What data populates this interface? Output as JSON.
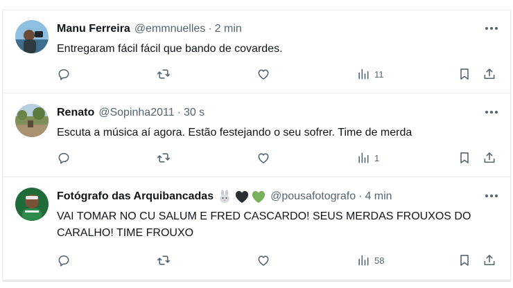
{
  "posts": [
    {
      "name": "Manu Ferreira",
      "handle": "@emmnuelles",
      "separator": "·",
      "time": "2 min",
      "text": "Entregaram fácil fácil que bando de covardes.",
      "views": "11",
      "icons": [
        "reply-icon",
        "repost-icon",
        "like-icon",
        "views-icon",
        "bookmark-icon",
        "share-icon"
      ]
    },
    {
      "name": "Renato",
      "handle": "@Sopinha2011",
      "separator": "·",
      "time": "30 s",
      "text": "Escuta a música aí agora.  Estão festejando o seu sofrer.  Time de merda",
      "views": "1",
      "icons": [
        "reply-icon",
        "repost-icon",
        "like-icon",
        "views-icon",
        "bookmark-icon",
        "share-icon"
      ]
    },
    {
      "name": "Fotógrafo das Arquibancadas",
      "name_emojis": [
        "rabbit-emoji",
        "black-heart-emoji",
        "green-heart-emoji"
      ],
      "handle": "@pousafotografo",
      "separator": "·",
      "time": "4 min",
      "text": "VAI TOMAR NO CU SALUM E FRED CASCARDO! SEUS MERDAS FROUXOS DO CARALHO! TIME FROUXO",
      "views": "58",
      "icons": [
        "reply-icon",
        "repost-icon",
        "like-icon",
        "views-icon",
        "bookmark-icon",
        "share-icon"
      ]
    }
  ],
  "colors": {
    "text": "#0f1419",
    "secondary": "#536471",
    "divider": "#e7e9ea",
    "green_heart": "#78b159"
  }
}
